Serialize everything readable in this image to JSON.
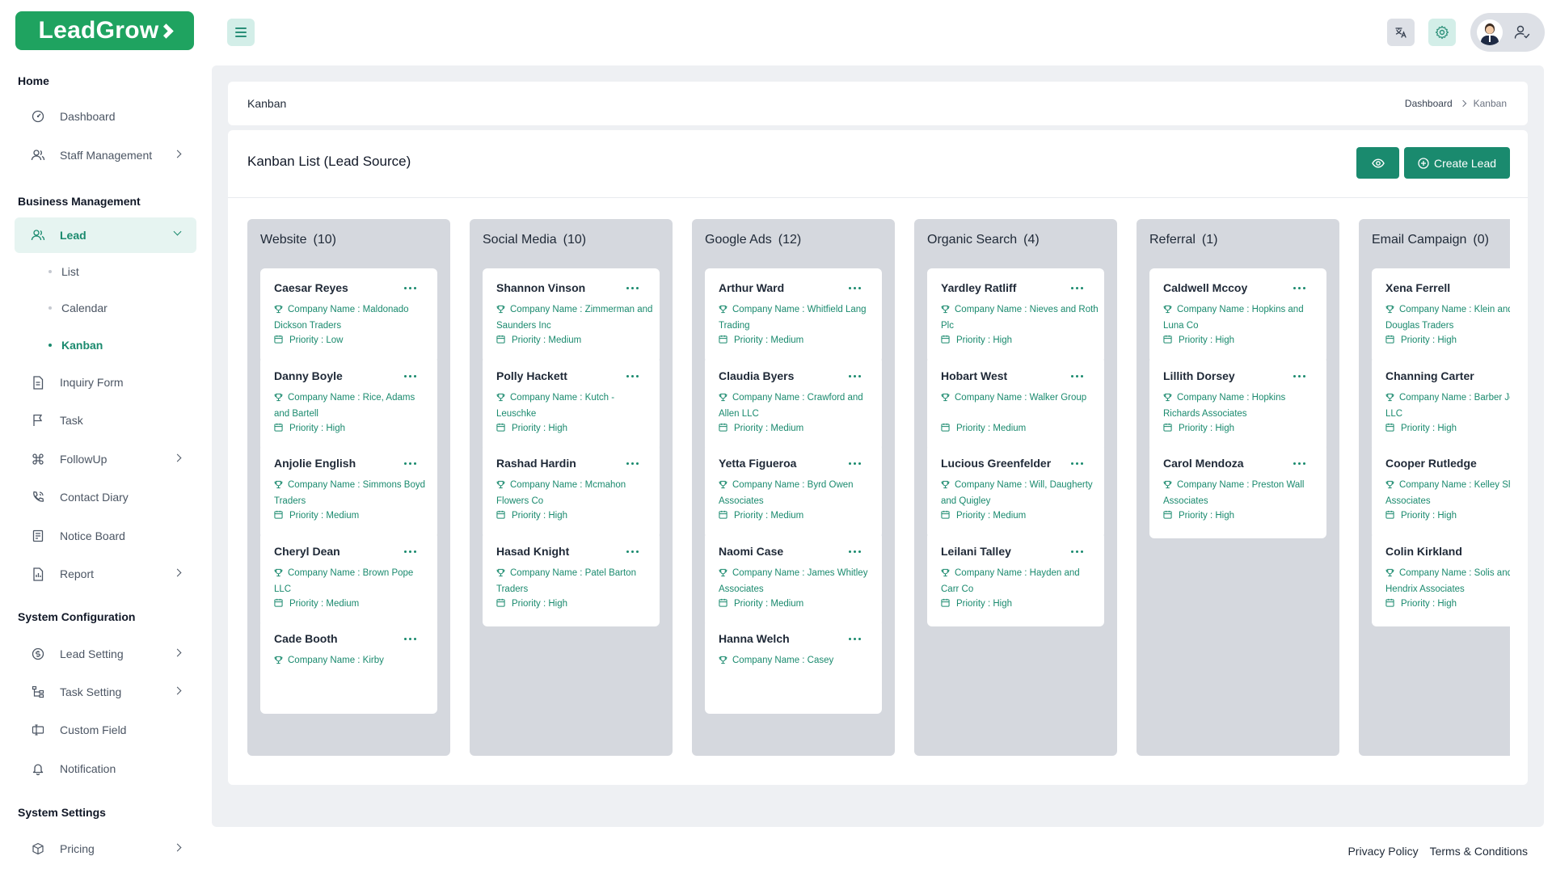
{
  "header": {
    "logo": "LeadGrow",
    "translate_icon": "translate-icon",
    "settings_icon": "gear-icon",
    "profile_icon": "user-check-icon"
  },
  "sidebar": {
    "sections": [
      {
        "title": "Home"
      },
      {
        "title": "Business Management"
      },
      {
        "title": "System Configuration"
      },
      {
        "title": "System Settings"
      }
    ],
    "items": [
      {
        "label": "Dashboard",
        "icon": "dashboard-icon"
      },
      {
        "label": "Staff Management",
        "icon": "users-icon"
      },
      {
        "label": "Lead",
        "icon": "users-icon"
      },
      {
        "label": "Inquiry Form",
        "icon": "document-icon"
      },
      {
        "label": "Task",
        "icon": "flag-icon"
      },
      {
        "label": "FollowUp",
        "icon": "command-icon"
      },
      {
        "label": "Contact Diary",
        "icon": "phone-icon"
      },
      {
        "label": "Notice Board",
        "icon": "notice-icon"
      },
      {
        "label": "Report",
        "icon": "report-icon"
      },
      {
        "label": "Lead Setting",
        "icon": "dollar-icon"
      },
      {
        "label": "Task Setting",
        "icon": "hierarchy-icon"
      },
      {
        "label": "Custom Field",
        "icon": "custom-field-icon"
      },
      {
        "label": "Notification",
        "icon": "bell-icon"
      },
      {
        "label": "Pricing",
        "icon": "package-icon"
      }
    ],
    "lead_sub": [
      "List",
      "Calendar",
      "Kanban"
    ]
  },
  "breadcrumb": {
    "title": "Kanban",
    "home": "Dashboard",
    "current": "Kanban"
  },
  "kanban": {
    "title": "Kanban List (Lead Source)",
    "create_label": "Create Lead",
    "columns": [
      {
        "name": "Website",
        "count": "(10)",
        "cards": [
          {
            "name": "Caesar Reyes",
            "company": "Company Name : Maldonado Dickson Traders",
            "priority": "Priority : Low"
          },
          {
            "name": "Danny Boyle",
            "company": "Company Name : Rice, Adams and Bartell",
            "priority": "Priority : High"
          },
          {
            "name": "Anjolie English",
            "company": "Company Name : Simmons Boyd Traders",
            "priority": "Priority : Medium"
          },
          {
            "name": "Cheryl Dean",
            "company": "Company Name : Brown Pope LLC",
            "priority": "Priority : Medium"
          },
          {
            "name": "Cade Booth",
            "company": "Company Name : Kirby",
            "priority": ""
          }
        ]
      },
      {
        "name": "Social Media",
        "count": "(10)",
        "cards": [
          {
            "name": "Shannon Vinson",
            "company": "Company Name : Zimmerman and Saunders Inc",
            "priority": "Priority : Medium"
          },
          {
            "name": "Polly Hackett",
            "company": "Company Name : Kutch - Leuschke",
            "priority": "Priority : High"
          },
          {
            "name": "Rashad Hardin",
            "company": "Company Name : Mcmahon Flowers Co",
            "priority": "Priority : High"
          },
          {
            "name": "Hasad Knight",
            "company": "Company Name : Patel Barton Traders",
            "priority": "Priority : High"
          }
        ]
      },
      {
        "name": "Google Ads",
        "count": "(12)",
        "cards": [
          {
            "name": "Arthur Ward",
            "company": "Company Name : Whitfield Lang Trading",
            "priority": "Priority : Medium"
          },
          {
            "name": "Claudia Byers",
            "company": "Company Name : Crawford and Allen LLC",
            "priority": "Priority : Medium"
          },
          {
            "name": "Yetta Figueroa",
            "company": "Company Name : Byrd Owen Associates",
            "priority": "Priority : Medium"
          },
          {
            "name": "Naomi Case",
            "company": "Company Name : James Whitley Associates",
            "priority": "Priority : Medium"
          },
          {
            "name": "Hanna Welch",
            "company": "Company Name : Casey",
            "priority": ""
          }
        ]
      },
      {
        "name": "Organic Search",
        "count": "(4)",
        "cards": [
          {
            "name": "Yardley Ratliff",
            "company": "Company Name : Nieves and Roth Plc",
            "priority": "Priority : High"
          },
          {
            "name": "Hobart West",
            "company": "Company Name : Walker Group",
            "priority": "Priority : Medium"
          },
          {
            "name": "Lucious Greenfelder",
            "company": "Company Name : Will, Daugherty and Quigley",
            "priority": "Priority : Medium"
          },
          {
            "name": "Leilani Talley",
            "company": "Company Name : Hayden and Carr Co",
            "priority": "Priority : High"
          }
        ]
      },
      {
        "name": "Referral",
        "count": "(1)",
        "cards": [
          {
            "name": "Caldwell Mccoy",
            "company": "Company Name : Hopkins and Luna Co",
            "priority": "Priority : High"
          },
          {
            "name": "Lillith Dorsey",
            "company": "Company Name : Hopkins Richards Associates",
            "priority": "Priority : High"
          },
          {
            "name": "Carol Mendoza",
            "company": "Company Name : Preston Wall Associates",
            "priority": "Priority : High"
          }
        ]
      },
      {
        "name": "Email Campaign",
        "count": "(0)",
        "cards": [
          {
            "name": "Xena Ferrell",
            "company": "Company Name : Klein and Douglas Traders",
            "priority": "Priority : High"
          },
          {
            "name": "Channing Carter",
            "company": "Company Name : Barber Jefferson LLC",
            "priority": "Priority : High"
          },
          {
            "name": "Cooper Rutledge",
            "company": "Company Name : Kelley Shields Associates",
            "priority": "Priority : High"
          },
          {
            "name": "Colin Kirkland",
            "company": "Company Name : Solis and Hendrix Associates",
            "priority": "Priority : High"
          }
        ]
      }
    ]
  },
  "footer": {
    "privacy": "Privacy Policy",
    "terms": "Terms & Conditions"
  },
  "colors": {
    "accent": "#1a8a6e",
    "brand": "#1fa360",
    "column_bg": "#d5d8de",
    "page_bg": "#eef0f3"
  }
}
